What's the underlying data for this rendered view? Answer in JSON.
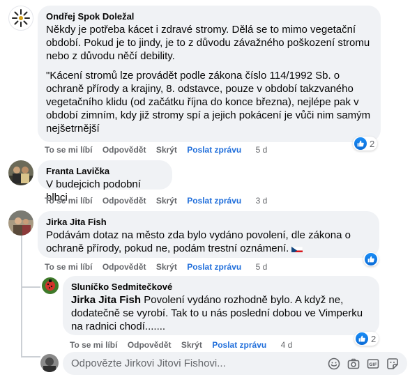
{
  "comments": [
    {
      "author": "Ondřej Spok Doležal",
      "paragraphs": [
        "Někdy je potřeba kácet i zdravé stromy. Dělá se to mimo vegetační období. Pokud je to jindy, je to z důvodu závažného poškození stromu nebo z důvodu něčí debility.",
        "\"Kácení stromů lze provádět podle zákona číslo 114/1992 Sb. o ochraně přírody a krajiny, 8. odstavce, pouze v období takzvaného vegetačního klidu (od začátku října do konce března), nejlépe pak v období zimním, kdy již stromy spí a jejich pokácení je vůči nim samým nejšetrnější"
      ],
      "actions": {
        "like": "To se mi líbí",
        "reply": "Odpovědět",
        "hide": "Skrýt",
        "message": "Poslat zprávu",
        "time": "5 d"
      },
      "reaction_count": "2"
    },
    {
      "author": "Franta Lavička",
      "text": "V budejcich podobní blbci",
      "actions": {
        "like": "To se mi líbí",
        "reply": "Odpovědět",
        "hide": "Skrýt",
        "message": "Poslat zprávu",
        "time": "3 d"
      }
    },
    {
      "author": "Jirka Jita Fish",
      "text": "Podávám dotaz na město zda bylo vydáno povolení, dle zákona o ochraně přírody, pokud ne, podám trestní oznámení.",
      "actions": {
        "like": "To se mi líbí",
        "reply": "Odpovědět",
        "hide": "Skrýt",
        "message": "Poslat zprávu",
        "time": "5 d"
      },
      "reaction_count": ""
    },
    {
      "author": "Sluníčko Sedmitečkové",
      "mention": "Jirka Jita Fish",
      "text": "Povolení vydáno rozhodně bylo. A když ne, dodatečně se vyrobí. Tak to u nás poslední dobou ve Vimperku na radnici chodí.......",
      "actions": {
        "like": "To se mi líbí",
        "reply": "Odpovědět",
        "hide": "Skrýt",
        "message": "Poslat zprávu",
        "time": "4 d"
      },
      "reaction_count": "2"
    }
  ],
  "reply_box": {
    "placeholder": "Odpovězte Jirkovi Jitovi Fishovi..."
  },
  "icons": [
    "emoji-icon",
    "camera-icon",
    "gif-icon",
    "sticker-icon"
  ],
  "colors": {
    "bubble": "#f0f2f5",
    "link": "#216fdb",
    "muted": "#65676b",
    "like": "#1877f2"
  }
}
